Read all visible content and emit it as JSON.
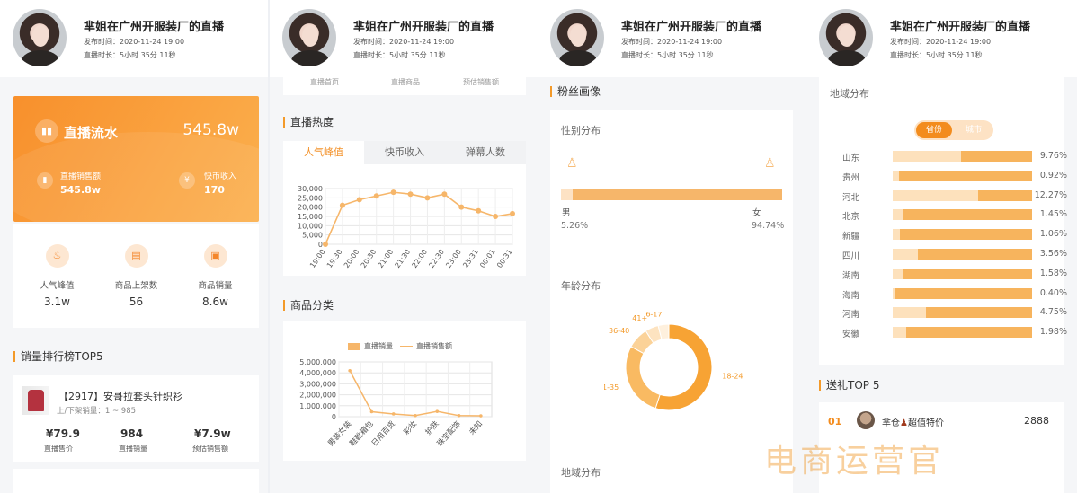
{
  "header": {
    "title": "芈姐在广州开服装厂的直播",
    "publish_time": "发布时间：2020-11-24 19:00",
    "duration": "直播时长：5小时 35分 11秒"
  },
  "flow": {
    "title": "直播流水",
    "value": "545.8w",
    "sales_label": "直播销售额",
    "sales_value": "545.8w",
    "coin_label": "快币收入",
    "coin_value": "170"
  },
  "stats": [
    {
      "label": "人气峰值",
      "value": "3.1w"
    },
    {
      "label": "商品上架数",
      "value": "56"
    },
    {
      "label": "商品销量",
      "value": "8.6w"
    }
  ],
  "ranking": {
    "section_title": "销量排行榜TOP5",
    "item_name": "【2917】安哥拉套头针织衫",
    "item_sub": "上/下架销量：1 ~ 985",
    "price": "¥79.9",
    "price_label": "直播售价",
    "sales": "984",
    "sales_label": "直播销量",
    "revenue": "¥7.9w",
    "revenue_label": "预估销售额"
  },
  "partial_labels": [
    "直播首页",
    "直播商品",
    "预估销售额"
  ],
  "heat": {
    "section_title": "直播热度",
    "tabs": [
      "人气峰值",
      "快币收入",
      "弹幕人数"
    ]
  },
  "category": {
    "section_title": "商品分类",
    "legend_a": "直播销量",
    "legend_b": "直播销售额"
  },
  "fans": {
    "section_title": "粉丝画像",
    "gender_title": "性别分布",
    "male": "男",
    "female": "女",
    "male_pct": "5.26%",
    "female_pct": "94.74%",
    "age_title": "年龄分布",
    "region_title": "地域分布"
  },
  "region": {
    "title": "地域分布",
    "toggle_on": "省份",
    "toggle_off": "城市",
    "rows": [
      {
        "name": "山东",
        "pct": "9.76%"
      },
      {
        "name": "贵州",
        "pct": "0.92%"
      },
      {
        "name": "河北",
        "pct": "12.27%"
      },
      {
        "name": "北京",
        "pct": "1.45%"
      },
      {
        "name": "新疆",
        "pct": "1.06%"
      },
      {
        "name": "四川",
        "pct": "3.56%"
      },
      {
        "name": "湖南",
        "pct": "1.58%"
      },
      {
        "name": "海南",
        "pct": "0.40%"
      },
      {
        "name": "河南",
        "pct": "4.75%"
      },
      {
        "name": "安徽",
        "pct": "1.98%"
      }
    ]
  },
  "gift": {
    "section_title": "送礼TOP 5",
    "rank": "01",
    "name": "芈仓",
    "suffix": "超值特价",
    "value": "2888"
  },
  "watermark": "电商运营官",
  "chart_data": [
    {
      "type": "line",
      "x": [
        "19:00",
        "19:30",
        "20:00",
        "20:30",
        "21:00",
        "21:30",
        "22:00",
        "22:30",
        "23:00",
        "23:31",
        "00:01",
        "00:31"
      ],
      "y": [
        0,
        21000,
        24000,
        26000,
        28000,
        27000,
        25000,
        27000,
        20000,
        18000,
        15000,
        16500
      ],
      "yticks": [
        "0",
        "5,000",
        "10,000",
        "15,000",
        "20,000",
        "25,000",
        "30,000"
      ],
      "ylim": [
        0,
        30000
      ],
      "colors": {
        "line": "#f6b66a"
      }
    },
    {
      "type": "line",
      "categories": [
        "男装女装",
        "鞋靴箱包",
        "日用百货",
        "彩妆",
        "护肤",
        "珠宝配饰",
        "未知"
      ],
      "series": [
        {
          "name": "直播销量",
          "values": [
            4200000,
            450000,
            250000,
            100000,
            480000,
            100000,
            80000
          ]
        }
      ],
      "yticks": [
        "0",
        "1,000,000",
        "2,000,000",
        "3,000,000",
        "4,000,000",
        "5,000,000"
      ],
      "ylim": [
        0,
        5000000
      ]
    },
    {
      "type": "pie",
      "labels": [
        "18-24",
        "31-35",
        "36-40",
        "41+",
        "6-17"
      ],
      "values": [
        55,
        28,
        8,
        5,
        4
      ]
    },
    {
      "type": "bar",
      "categories": [
        "男",
        "女"
      ],
      "values": [
        5.26,
        94.74
      ]
    },
    {
      "type": "bar",
      "categories": [
        "山东",
        "贵州",
        "河北",
        "北京",
        "新疆",
        "四川",
        "湖南",
        "海南",
        "河南",
        "安徽"
      ],
      "values": [
        9.76,
        0.92,
        12.27,
        1.45,
        1.06,
        3.56,
        1.58,
        0.4,
        4.75,
        1.98
      ]
    }
  ]
}
